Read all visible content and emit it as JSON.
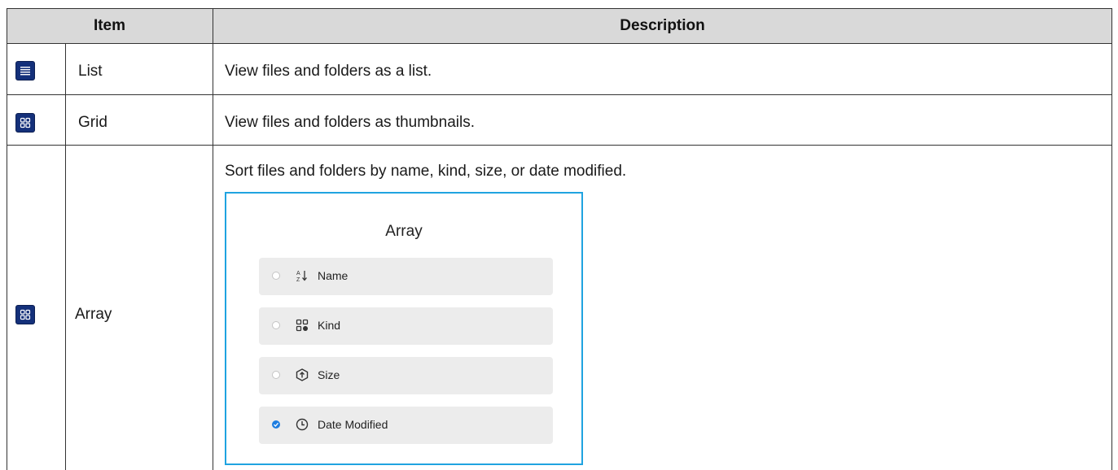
{
  "header": {
    "item": "Item",
    "description": "Description"
  },
  "rows": [
    {
      "icon": "list-icon",
      "item": "List",
      "description": "View files and folders as a list."
    },
    {
      "icon": "grid-icon",
      "item": "Grid",
      "description": "View files and folders as thumbnails."
    },
    {
      "icon": "grid-icon",
      "item": "Array",
      "description": "Sort files and folders by name, kind, size, or date modified."
    }
  ],
  "popup": {
    "title": "Array",
    "options": [
      {
        "label": "Name",
        "icon": "sort-az-icon",
        "checked": false
      },
      {
        "label": "Kind",
        "icon": "kind-icon",
        "checked": false
      },
      {
        "label": "Size",
        "icon": "size-icon",
        "checked": false
      },
      {
        "label": "Date Modified",
        "icon": "clock-icon",
        "checked": true
      }
    ]
  },
  "colors": {
    "header_bg": "#d9d9d9",
    "icon_bg": "#14307a",
    "popup_border": "#1fa3e0",
    "accent": "#1e7de0"
  }
}
